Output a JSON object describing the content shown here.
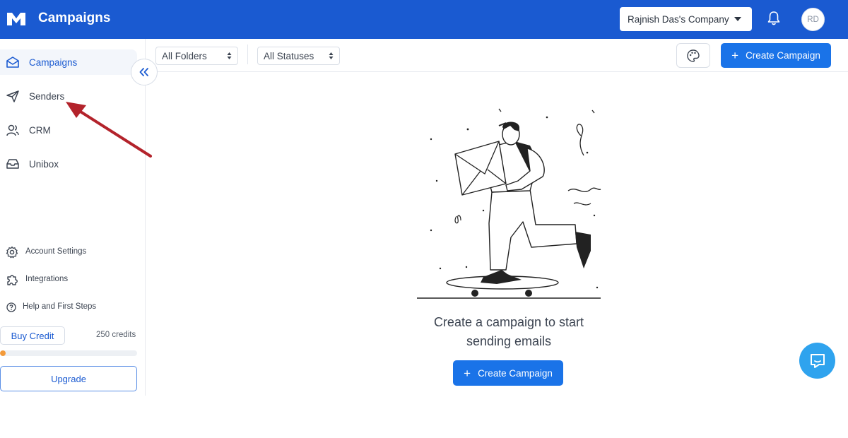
{
  "header": {
    "title": "Campaigns",
    "company": "Rajnish Das's Company",
    "avatar_initials": "RD"
  },
  "sidebar": {
    "items": [
      {
        "label": "Campaigns",
        "icon": "inbox-mail-icon",
        "active": true
      },
      {
        "label": "Senders",
        "icon": "send-icon",
        "active": false
      },
      {
        "label": "CRM",
        "icon": "users-icon",
        "active": false
      },
      {
        "label": "Unibox",
        "icon": "tray-icon",
        "active": false
      }
    ],
    "bottom_items": [
      {
        "label": "Account Settings",
        "icon": "gear-icon"
      },
      {
        "label": "Integrations",
        "icon": "puzzle-icon"
      },
      {
        "label": "Help and First Steps",
        "icon": "help-circle-icon"
      }
    ],
    "buy_credit_label": "Buy Credit",
    "credits_text": "250 credits",
    "credit_progress_percent": 4,
    "upgrade_label": "Upgrade"
  },
  "toolbar": {
    "folder_filter": "All Folders",
    "status_filter": "All Statuses",
    "create_label": "Create Campaign"
  },
  "empty_state": {
    "line1": "Create a campaign to start",
    "line2": "sending emails",
    "create_label": "Create Campaign"
  },
  "colors": {
    "brand": "#1a5ad1",
    "primary_button": "#1a73e8",
    "chat": "#2fa3ee",
    "annotation_arrow": "#b3232b",
    "progress": "#f39a3a"
  }
}
